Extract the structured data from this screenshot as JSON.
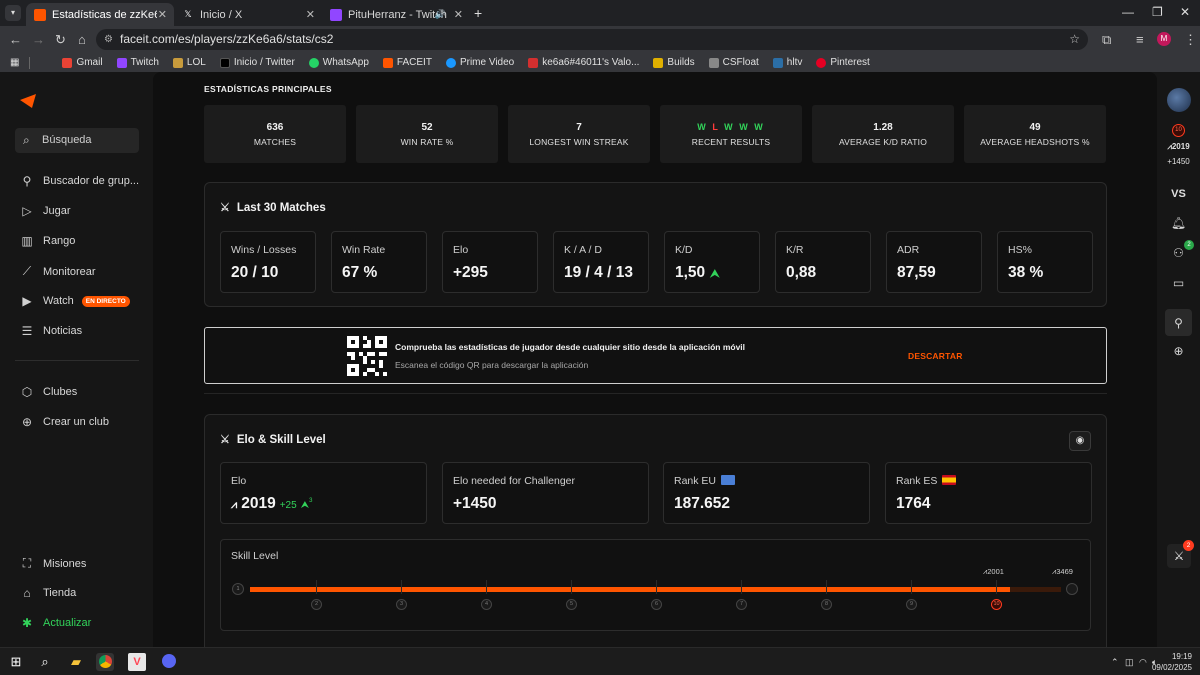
{
  "browser": {
    "tabs": [
      {
        "title": "Estadísticas de zzKe6a6 - FACEIT",
        "active": true
      },
      {
        "title": "Inicio / X",
        "active": false
      },
      {
        "title": "PituHerranz - Twitch",
        "active": false
      }
    ],
    "url": "faceit.com/es/players/zzKe6a6/stats/cs2",
    "profile_initial": "M",
    "bookmarks": [
      "Gmail",
      "Twitch",
      "LOL",
      "Inicio / Twitter",
      "WhatsApp",
      "FACEIT",
      "Prime Video",
      "ke6a6#46011's Valo...",
      "Builds",
      "CSFloat",
      "hltv",
      "Pinterest"
    ]
  },
  "sidebar": {
    "search_placeholder": "Búsqueda",
    "items": [
      {
        "label": "Buscador de grup...",
        "icon": "group-finder-icon"
      },
      {
        "label": "Jugar",
        "icon": "play-icon"
      },
      {
        "label": "Rango",
        "icon": "rank-icon"
      },
      {
        "label": "Monitorear",
        "icon": "monitor-icon"
      },
      {
        "label": "Watch",
        "icon": "watch-icon",
        "badge": "EN DIRECTO"
      },
      {
        "label": "Noticias",
        "icon": "news-icon"
      }
    ],
    "clubs": [
      {
        "label": "Clubes",
        "icon": "clubs-icon"
      },
      {
        "label": "Crear un club",
        "icon": "plus-circle-icon"
      }
    ],
    "bottom": [
      {
        "label": "Misiones",
        "icon": "missions-icon"
      },
      {
        "label": "Tienda",
        "icon": "shop-icon"
      },
      {
        "label": "Actualizar",
        "icon": "upgrade-icon"
      }
    ]
  },
  "main": {
    "section_title": "ESTADÍSTICAS PRINCIPALES",
    "stats": [
      {
        "value": "636",
        "label": "MATCHES"
      },
      {
        "value": "52",
        "label": "WIN RATE %"
      },
      {
        "value": "7",
        "label": "LONGEST WIN STREAK"
      },
      {
        "value": "",
        "label": "RECENT RESULTS"
      },
      {
        "value": "1.28",
        "label": "AVERAGE K/D RATIO"
      },
      {
        "value": "49",
        "label": "AVERAGE HEADSHOTS %"
      }
    ],
    "recent_results": [
      "W",
      "L",
      "W",
      "W",
      "W"
    ],
    "last30": {
      "title": "Last 30 Matches",
      "cards": [
        {
          "label": "Wins / Losses",
          "value": "20 / 10"
        },
        {
          "label": "Win Rate",
          "value": "67 %"
        },
        {
          "label": "Elo",
          "value": "+295"
        },
        {
          "label": "K / A / D",
          "value": "19 / 4 / 13"
        },
        {
          "label": "K/D",
          "value": "1,50"
        },
        {
          "label": "K/R",
          "value": "0,88"
        },
        {
          "label": "ADR",
          "value": "87,59"
        },
        {
          "label": "HS%",
          "value": "38 %"
        }
      ]
    },
    "banner": {
      "title": "Comprueba las estadísticas de jugador desde cualquier sitio desde la aplicación móvil",
      "subtitle": "Escanea el código QR para descargar la aplicación",
      "dismiss": "DESCARTAR"
    },
    "elo": {
      "title": "Elo & Skill Level",
      "cards": [
        {
          "label": "Elo",
          "value": "2019",
          "delta": "+25",
          "delta_sup": "3"
        },
        {
          "label": "Elo needed for Challenger",
          "value": "+1450"
        },
        {
          "label": "Rank EU",
          "value": "187.652"
        },
        {
          "label": "Rank ES",
          "value": "1764"
        }
      ],
      "skill_label": "Skill Level",
      "levels": [
        "1",
        "2",
        "3",
        "4",
        "5",
        "6",
        "7",
        "8",
        "9",
        "10"
      ],
      "current_level": "10",
      "marker_current": "2001",
      "marker_max": "3469",
      "progress_fraction": 0.937
    }
  },
  "rail": {
    "elo": "2019",
    "needed": "+1450",
    "vs": "VS",
    "friends_count": "2",
    "party_count": "2"
  },
  "taskbar": {
    "time": "19:19",
    "date": "09/02/2025"
  },
  "colors": {
    "accent": "#ff5500",
    "win": "#32d35a",
    "loss": "#ff3b3b"
  }
}
